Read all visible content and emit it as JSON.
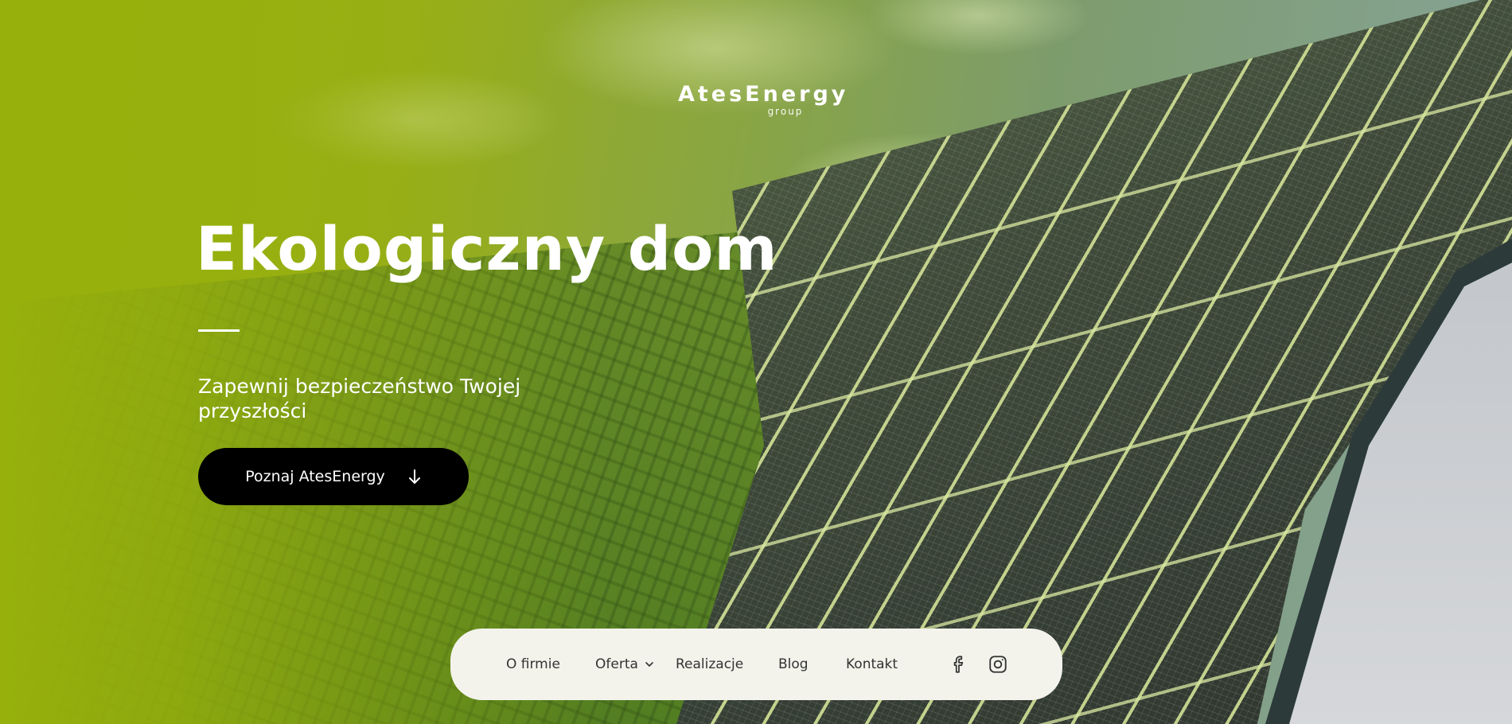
{
  "brand": {
    "name": "AtesEnergy",
    "tagline": "group"
  },
  "hero": {
    "headline": "Ekologiczny dom",
    "subtitle": "Zapewnij bezpieczeństwo Twojej przyszłości",
    "cta_label": "Poznaj AtesEnergy",
    "cta_icon": "arrow-down-icon"
  },
  "nav": {
    "items": [
      {
        "label": "O firmie"
      },
      {
        "label": "Oferta",
        "has_dropdown": true
      },
      {
        "label": "Realizacje"
      },
      {
        "label": "Blog"
      },
      {
        "label": "Kontakt"
      }
    ],
    "social": [
      "facebook-icon",
      "instagram-icon"
    ]
  },
  "colors": {
    "accent_green": "#97b00c",
    "cta_background": "#000000",
    "nav_background": "#f3f3ec",
    "text_light": "#ffffff",
    "text_dark": "#333333"
  }
}
